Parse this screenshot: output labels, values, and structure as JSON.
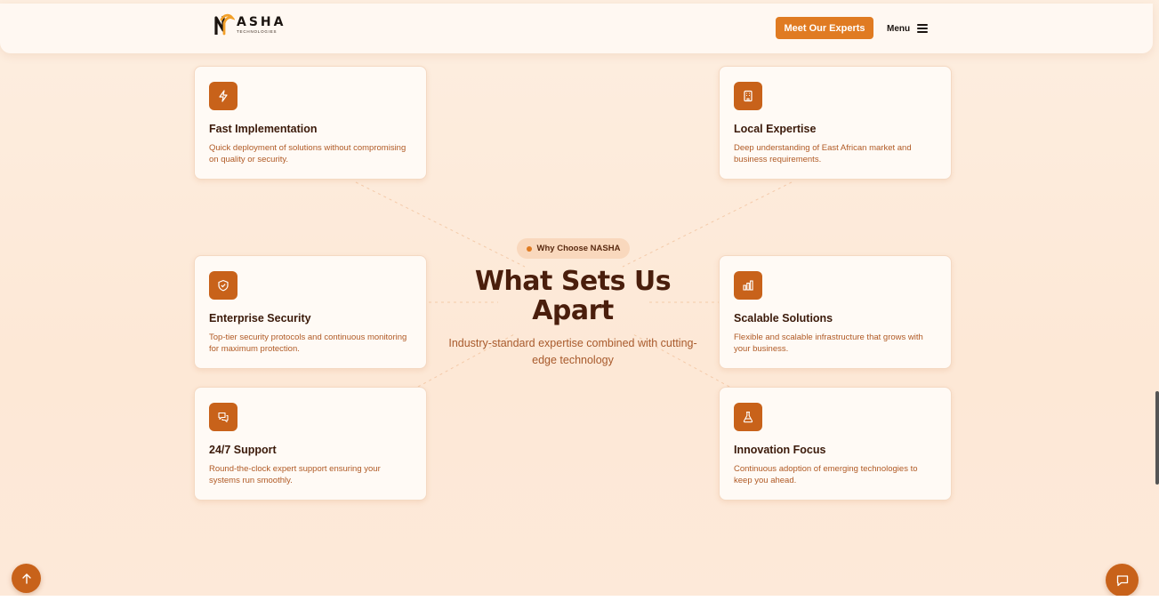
{
  "header": {
    "logo_name": "ASHA",
    "logo_sub": "TECHNOLOGIES",
    "cta_label": "Meet Our Experts",
    "menu_label": "Menu"
  },
  "center": {
    "badge": "Why Choose NASHA",
    "title_line1": "What Sets Us",
    "title_line2": "Apart",
    "subtitle": "Industry-standard expertise combined with cutting-edge technology"
  },
  "cards": [
    {
      "title": "Fast Implementation",
      "desc": "Quick deployment of solutions without compromising on quality or security.",
      "icon": "lightning-icon"
    },
    {
      "title": "Local Expertise",
      "desc": "Deep understanding of East African market and business requirements.",
      "icon": "building-icon"
    },
    {
      "title": "Enterprise Security",
      "desc": "Top-tier security protocols and continuous monitoring for maximum protection.",
      "icon": "shield-check-icon"
    },
    {
      "title": "Scalable Solutions",
      "desc": "Flexible and scalable infrastructure that grows with your business.",
      "icon": "bar-chart-icon"
    },
    {
      "title": "24/7 Support",
      "desc": "Round-the-clock expert support ensuring your systems run smoothly.",
      "icon": "chat-bubbles-icon"
    },
    {
      "title": "Innovation Focus",
      "desc": "Continuous adoption of emerging technologies to keep you ahead.",
      "icon": "flask-icon"
    }
  ],
  "colors": {
    "accent": "#e07b22",
    "icon_bg": "#c8621a",
    "heading": "#4a1e0c",
    "description": "#b05a25"
  }
}
